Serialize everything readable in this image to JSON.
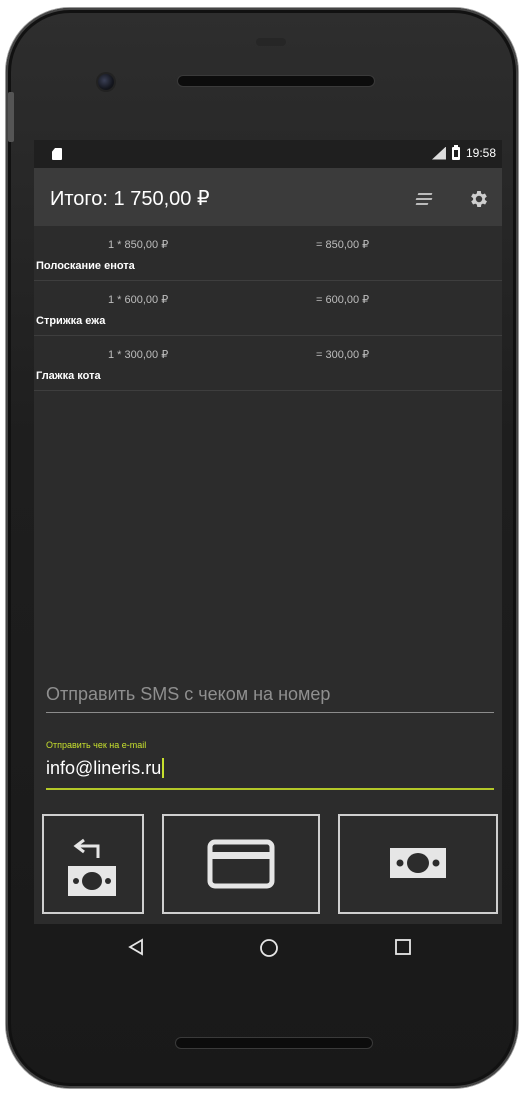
{
  "status_bar": {
    "time": "19:58"
  },
  "app_bar": {
    "title": "Итого: 1 750,00 ₽"
  },
  "items": [
    {
      "quantity_price": "1 * 850,00 ₽",
      "total": "= 850,00 ₽",
      "name": "Полоскание енота"
    },
    {
      "quantity_price": "1 * 600,00 ₽",
      "total": "= 600,00 ₽",
      "name": "Стрижка ежа"
    },
    {
      "quantity_price": "1 * 300,00 ₽",
      "total": "= 300,00 ₽",
      "name": "Глажка кота"
    }
  ],
  "sms": {
    "placeholder": "Отправить SMS с чеком на номер",
    "value": ""
  },
  "email": {
    "label": "Отправить чек на e-mail",
    "value": "info@lineris.ru"
  },
  "colors": {
    "accent": "#c7e02e",
    "background": "#2c2c2c",
    "app_bar": "#3b3b3b"
  },
  "icons": {
    "menu": "lines-icon",
    "settings": "gear-icon",
    "refund": "refund-cash-icon",
    "card": "credit-card-icon",
    "cash": "cash-icon",
    "nav_back": "back-triangle-icon",
    "nav_home": "home-circle-icon",
    "nav_recents": "recents-square-icon"
  }
}
